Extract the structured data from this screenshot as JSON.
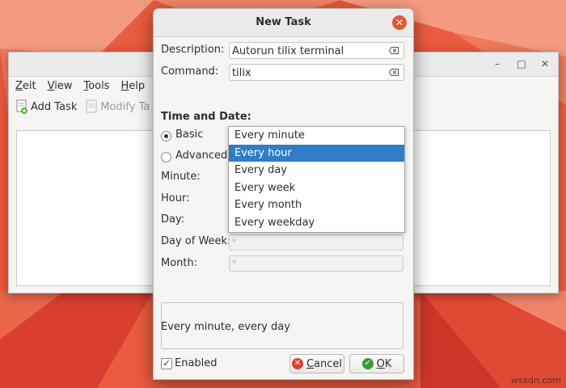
{
  "background_window": {
    "menu": [
      "Zeit",
      "View",
      "Tools",
      "Help"
    ],
    "toolbar": {
      "add_task": "Add Task",
      "modify_task": "Modify Ta"
    },
    "controls": {
      "minimize": "–",
      "maximize": "□",
      "close": "✕"
    }
  },
  "dialog": {
    "title": "New Task",
    "close_glyph": "✕",
    "description_label": "Description:",
    "description_value": "Autorun tilix terminal",
    "command_label": "Command:",
    "command_value": "tilix",
    "time_date_label": "Time and Date:",
    "radio_basic": "Basic",
    "radio_advanced": "Advanced",
    "minute_label": "Minute:",
    "hour_label": "Hour:",
    "day_label": "Day:",
    "dow_label": "Day of Week:",
    "dow_value": "*",
    "month_label": "Month:",
    "month_value": "*",
    "summary": "Every minute, every day",
    "enabled_label": "Enabled",
    "enabled_check": "✓",
    "cancel": "Cancel",
    "ok": "OK",
    "cancel_icon_glyph": "✕",
    "ok_icon_glyph": "✓"
  },
  "dropdown": {
    "options": [
      "Every minute",
      "Every hour",
      "Every day",
      "Every week",
      "Every month",
      "Every weekday"
    ],
    "selected": "Every hour"
  },
  "watermark": "wsxdn.com",
  "colors": {
    "accent": "#2f7cc7",
    "close_red": "#e25836",
    "ok_green": "#3a9a3a"
  }
}
